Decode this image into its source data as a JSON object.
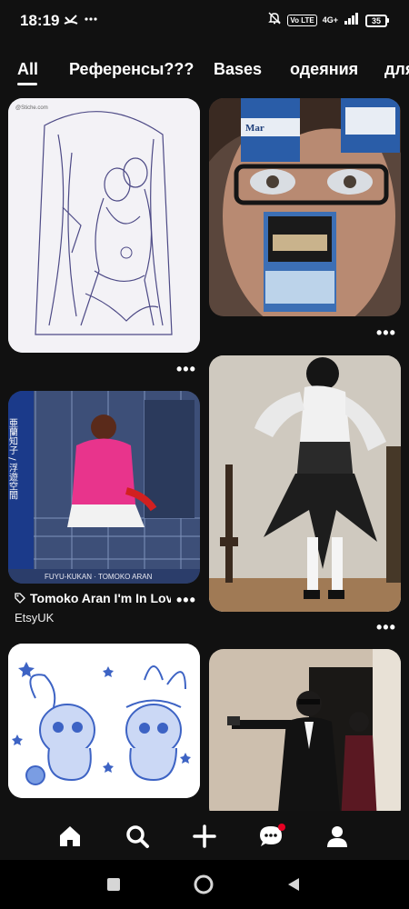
{
  "status_bar": {
    "time": "18:19",
    "network": "4G+",
    "volte": "Vo LTE",
    "battery": "35",
    "icons": [
      "missed-call-icon",
      "more-dots-icon",
      "mute-bell-icon",
      "signal-icon"
    ]
  },
  "tabs": [
    {
      "label": "All",
      "active": true
    },
    {
      "label": "Референсы???",
      "active": false
    },
    {
      "label": "Bases",
      "active": false
    },
    {
      "label": "одеяния",
      "active": false
    },
    {
      "label": "для",
      "active": false
    }
  ],
  "pins": [
    {
      "id": "pin-1",
      "kind": "sketch-drawing",
      "watermark": "@Stiche.com"
    },
    {
      "id": "pin-2",
      "kind": "photo-cigarette-glasses",
      "brand_text": "Mar"
    },
    {
      "id": "pin-3",
      "kind": "album-cover",
      "title": "Tomoko Aran I'm In Lov...",
      "source": "EtsyUK",
      "cover_text": "FUYU-KUKAN · TOMOKO ARAN",
      "cover_jp": "亜蘭知子 / 浮遊空間"
    },
    {
      "id": "pin-4",
      "kind": "photo-gothic-outfit"
    },
    {
      "id": "pin-5",
      "kind": "cute-bunny-drawing"
    },
    {
      "id": "pin-6",
      "kind": "photo-suits-gun"
    }
  ],
  "more_label": "•••",
  "nav": {
    "items": [
      "home-icon",
      "search-icon",
      "create-plus-icon",
      "messages-icon",
      "profile-icon"
    ],
    "has_notification": true
  },
  "colors": {
    "background": "#111111",
    "notification": "#e60023",
    "text": "#ffffff"
  }
}
